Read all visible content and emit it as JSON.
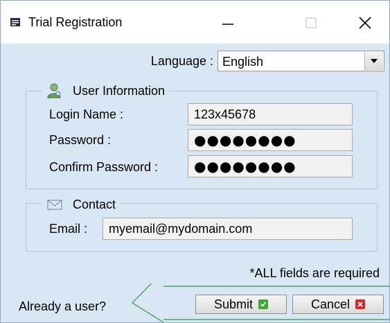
{
  "window": {
    "title": "Trial Registration"
  },
  "language": {
    "label": "Language :",
    "selected": "English"
  },
  "user_information": {
    "legend": "User Information",
    "login_name_label": "Login Name :",
    "login_name_value": "123x45678",
    "password_label": "Password :",
    "password_value": "●●●●●●●●",
    "confirm_password_label": "Confirm Password :",
    "confirm_password_value": "●●●●●●●●"
  },
  "contact": {
    "legend": "Contact",
    "email_label": "Email :",
    "email_value": "myemail@mydomain.com"
  },
  "note": "*ALL fields are required",
  "footer": {
    "already_user": "Already a user?",
    "submit_label": "Submit",
    "cancel_label": "Cancel"
  },
  "colors": {
    "submit_icon": "#3fa535",
    "cancel_icon": "#d9262d",
    "window_bg": "#d9e6f4"
  },
  "icons": {
    "app": "app-window-icon",
    "user": "user-icon",
    "contact": "envelope-icon",
    "submit": "check-icon",
    "cancel": "x-icon",
    "dropdown": "dropdown-arrow-icon"
  }
}
